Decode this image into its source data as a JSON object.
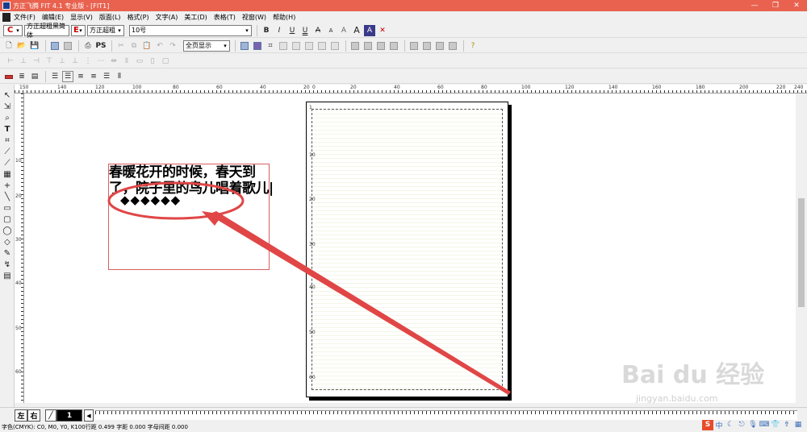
{
  "window": {
    "title": "方正飞腾 FIT 4.1 专业版 - [FIT1]",
    "controls": [
      "—",
      "❐",
      "✕"
    ]
  },
  "menu": [
    "文件(F)",
    "编辑(E)",
    "显示(V)",
    "版面(L)",
    "格式(P)",
    "文字(A)",
    "美工(D)",
    "表格(T)",
    "视窗(W)",
    "帮助(H)"
  ],
  "font_toolbar": {
    "c_label": "C",
    "chinese_font": "方正超粗黑简体",
    "e_label": "E",
    "english_font": "方正超粗",
    "size": "10号",
    "style_buttons": [
      "B",
      "I",
      "U",
      "U",
      "A",
      "A",
      "A",
      "A",
      "A",
      "✕"
    ]
  },
  "standard_toolbar": {
    "ps_label": "PS",
    "zoom": "全页显示"
  },
  "left_tools": [
    "↖",
    "⇲",
    "⌕",
    "T",
    "⌗",
    "⟋",
    "⟋",
    "▦",
    "+",
    "╲",
    "▭",
    "▢",
    "◯",
    "◇",
    "✎",
    "↯",
    "▤"
  ],
  "rulers": {
    "top": [
      "150",
      "140",
      "120",
      "100",
      "80",
      "60",
      "40",
      "20",
      "0",
      "20",
      "40",
      "60",
      "80",
      "100",
      "120",
      "140",
      "160",
      "180",
      "200",
      "220",
      "240"
    ],
    "left": [
      "10",
      "20",
      "30",
      "40",
      "50",
      "60"
    ],
    "page_marks": [
      "1",
      "10",
      "20",
      "30",
      "40",
      "50",
      "60"
    ]
  },
  "text_frame": {
    "line1": "春暖花开的时候，春天到",
    "line2": "了，院子里的鸟儿唱着歌儿|",
    "diamonds": "◆◆◆◆◆◆"
  },
  "page_tabs": {
    "left": "左",
    "right": "右",
    "current_page": "1"
  },
  "status": {
    "text": "字色(CMYK): C0, M0, Y0, K100行距 0.499 字距 0.000 字母间距 0.000"
  },
  "tray": [
    "S",
    "中",
    "☾",
    "⎋",
    "🎙",
    "⌨",
    "👕",
    "⇮",
    "▦"
  ],
  "watermark": {
    "brand": "Bai du 经验",
    "url": "jingyan.baidu.com"
  },
  "colors": {
    "titlebar": "#e8624f",
    "annotation": "#e04646",
    "frame_border": "#d86060"
  }
}
